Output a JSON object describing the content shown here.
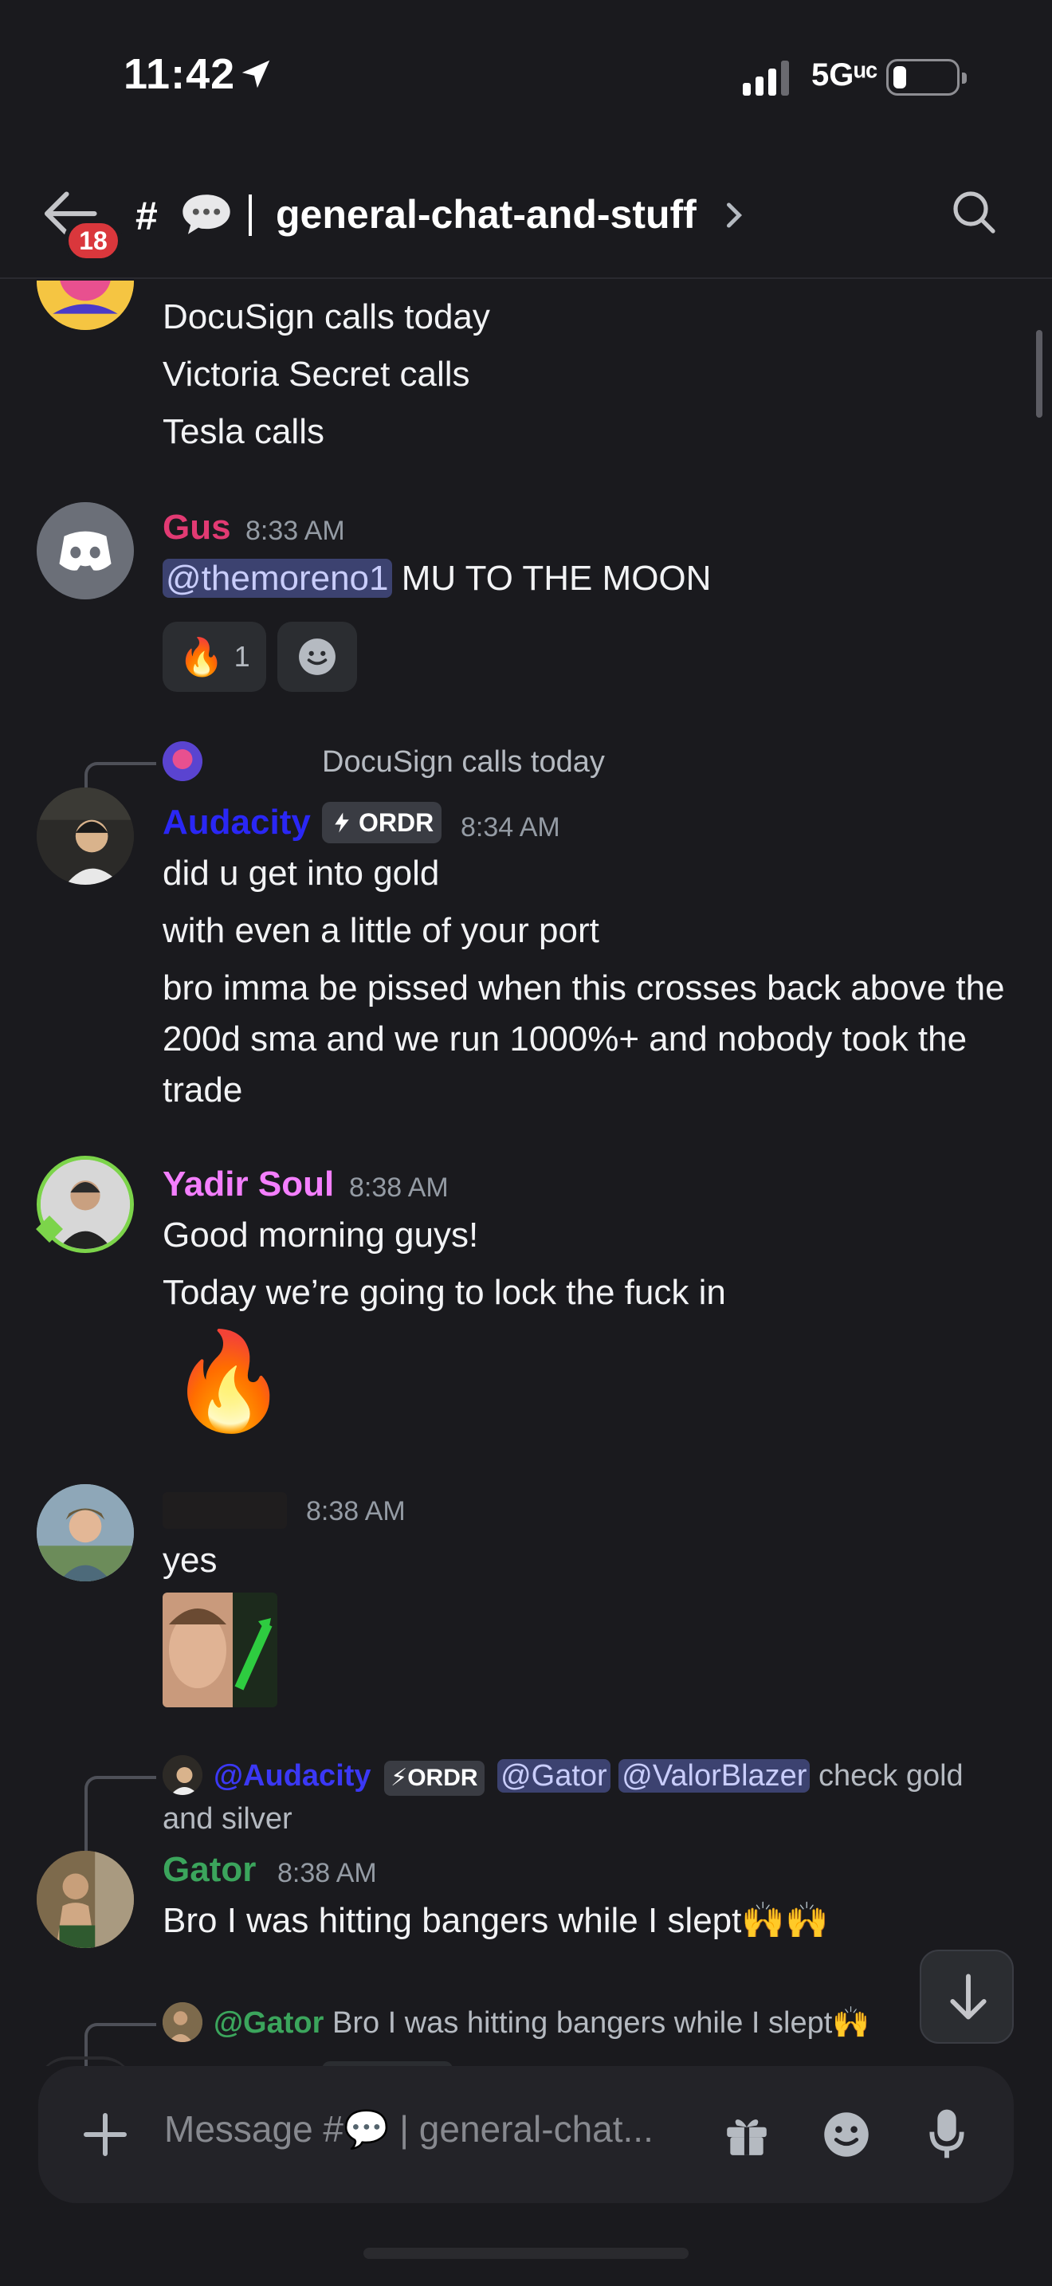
{
  "status_bar": {
    "time": "11:42",
    "network": "5Gᵘᶜ",
    "battery_level": 0.15
  },
  "header": {
    "back_badge": "18",
    "channel_prefix": "#",
    "channel_name": "general-chat-and-stuff",
    "icons": [
      "back-arrow-icon",
      "speech-bubble-icon",
      "chevron-right-icon",
      "search-icon"
    ]
  },
  "messages": {
    "m0": {
      "lines": [
        "DocuSign calls today",
        "Victoria Secret calls",
        "Tesla calls"
      ]
    },
    "m1": {
      "username": "Gus",
      "username_color": "#e23a73",
      "time": "8:33 AM",
      "mention": "@themoreno1",
      "text": " MU TO THE MOON",
      "reaction_count": "1"
    },
    "m2": {
      "reply_text": "DocuSign calls today",
      "username": "Audacity",
      "username_color": "#2a27f5",
      "tag": "ORDR",
      "time": "8:34 AM",
      "lines": [
        "did u get into gold",
        "with even a little of your port",
        "bro imma be pissed when this crosses back above the 200d sma and we run 1000%+ and nobody took the trade"
      ]
    },
    "m3": {
      "username": "Yadir Soul",
      "username_color": "#f47fff",
      "time": "8:38 AM",
      "lines": [
        "Good morning guys!",
        "Today we’re going to lock the fuck in"
      ]
    },
    "m4": {
      "time": "8:38 AM",
      "lines": [
        "yes"
      ]
    },
    "m5": {
      "reply_user": "@Audacity",
      "reply_tag": "ORDR",
      "reply_mention1": "@Gator",
      "reply_mention2": "@ValorBlazer",
      "reply_text": " check gold",
      "reply_text2": "and silver",
      "username": "Gator",
      "username_color": "#3ba55c",
      "time": "8:38 AM",
      "text": "Bro I was hitting bangers while I slept🙌🙌"
    },
    "m6": {
      "reply_user": "@Gator",
      "reply_text": "Bro I was hitting bangers while I slept🙌"
    }
  },
  "composer": {
    "placeholder": "Message #💬 | general-chat..."
  }
}
